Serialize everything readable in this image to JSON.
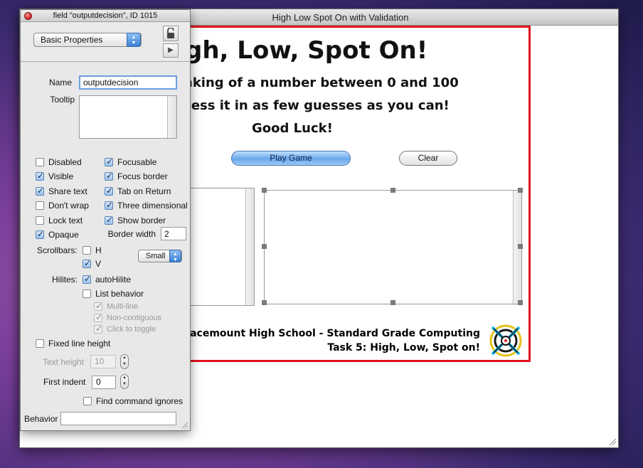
{
  "main_window": {
    "title": "High Low Spot On with Validation"
  },
  "card": {
    "heading": "gh, Low, Spot On!",
    "line1": "nking of a number between 0 and 100",
    "line2": "uess it in as few guesses as you can!",
    "line3": "Good Luck!",
    "play_button": "Play Game",
    "clear_button": "Clear",
    "footer_line1": "Gracemount High School - Standard Grade Computing",
    "footer_line2": "Task 5:  High, Low, Spot on!",
    "border_color": "#e0141c"
  },
  "inspector": {
    "title": "field \"outputdecision\", ID 1015",
    "property_set": "Basic Properties",
    "name_label": "Name",
    "name_value": "outputdecision",
    "tooltip_label": "Tooltip",
    "tooltip_value": "",
    "checkboxes_left": [
      {
        "label": "Disabled",
        "checked": false
      },
      {
        "label": "Visible",
        "checked": true
      },
      {
        "label": "Share text",
        "checked": true
      },
      {
        "label": "Don't wrap",
        "checked": false
      },
      {
        "label": "Lock text",
        "checked": false
      },
      {
        "label": "Opaque",
        "checked": true
      }
    ],
    "checkboxes_right": [
      {
        "label": "Focusable",
        "checked": true
      },
      {
        "label": "Focus border",
        "checked": true
      },
      {
        "label": "Tab on Return",
        "checked": true
      },
      {
        "label": "Three dimensional",
        "checked": true
      },
      {
        "label": "Show border",
        "checked": true
      }
    ],
    "border_width_label": "Border width",
    "border_width_value": "2",
    "scrollbars_label": "Scrollbars:",
    "scrollbar_h": {
      "label": "H",
      "checked": false
    },
    "scrollbar_v": {
      "label": "V",
      "checked": true
    },
    "scrollbar_size": "Small",
    "hilites_label": "Hilites:",
    "auto_hilite": {
      "label": "autoHilite",
      "checked": true
    },
    "list_behavior": {
      "label": "List behavior",
      "checked": false
    },
    "multi_line": {
      "label": "Multi-line",
      "checked": true
    },
    "non_contiguous": {
      "label": "Non-contiguous",
      "checked": true
    },
    "click_to_toggle": {
      "label": "Click to toggle",
      "checked": true
    },
    "fixed_line_height": {
      "label": "Fixed line height",
      "checked": false
    },
    "text_height_label": "Text height",
    "text_height_value": "10",
    "first_indent_label": "First indent",
    "first_indent_value": "0",
    "find_command_ignores": {
      "label": "Find command ignores",
      "checked": false
    },
    "behavior_label": "Behavior",
    "behavior_value": ""
  },
  "icons": [
    "close-dot-icon",
    "lock-icon",
    "play-icon",
    "stepper-arrows-icon",
    "logo-icon",
    "resize-grip-icon"
  ]
}
